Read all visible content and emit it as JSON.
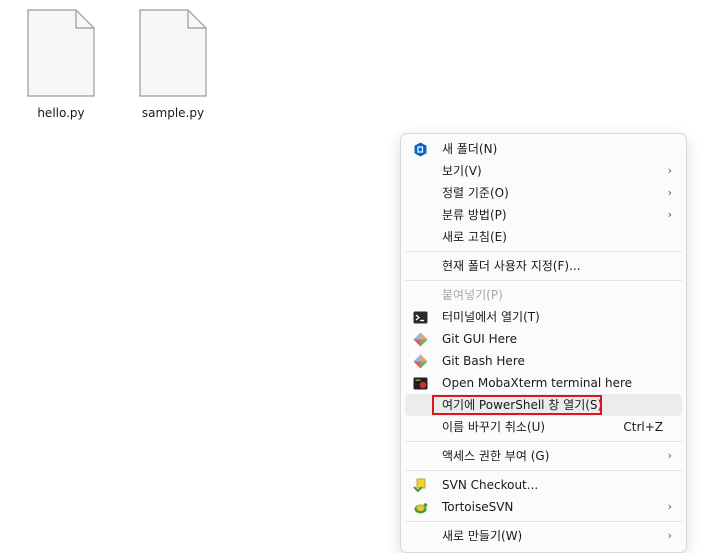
{
  "files": [
    {
      "name": "hello.py"
    },
    {
      "name": "sample.py"
    }
  ],
  "menu": {
    "items": [
      {
        "label": "새 폴더(N)",
        "icon": "new-folder-icon"
      },
      {
        "label": "보기(V)",
        "submenu": true
      },
      {
        "label": "정렬 기준(O)",
        "submenu": true
      },
      {
        "label": "분류 방법(P)",
        "submenu": true
      },
      {
        "label": "새로 고침(E)"
      },
      {
        "label": "현재 폴더 사용자 지정(F)..."
      },
      {
        "label": "붙여넣기(P)",
        "disabled": true
      },
      {
        "label": "터미널에서 열기(T)",
        "icon": "terminal-icon"
      },
      {
        "label": "Git GUI Here",
        "icon": "git-icon"
      },
      {
        "label": "Git Bash Here",
        "icon": "git-icon"
      },
      {
        "label": "Open MobaXterm terminal here",
        "icon": "mobaxterm-icon"
      },
      {
        "label": "여기에 PowerShell 창 열기(S)",
        "highlighted": true
      },
      {
        "label": "이름 바꾸기 취소(U)",
        "shortcut": "Ctrl+Z"
      },
      {
        "label": "액세스 권한 부여 (G)",
        "submenu": true
      },
      {
        "label": "SVN Checkout...",
        "icon": "svn-checkout-icon"
      },
      {
        "label": "TortoiseSVN",
        "icon": "tortoisesvn-icon",
        "submenu": true
      },
      {
        "label": "새로 만들기(W)",
        "submenu": true
      }
    ],
    "submenu_arrow": "›"
  },
  "colors": {
    "highlight_border": "#e0141f",
    "new_folder_icon": "#0a64c8"
  }
}
